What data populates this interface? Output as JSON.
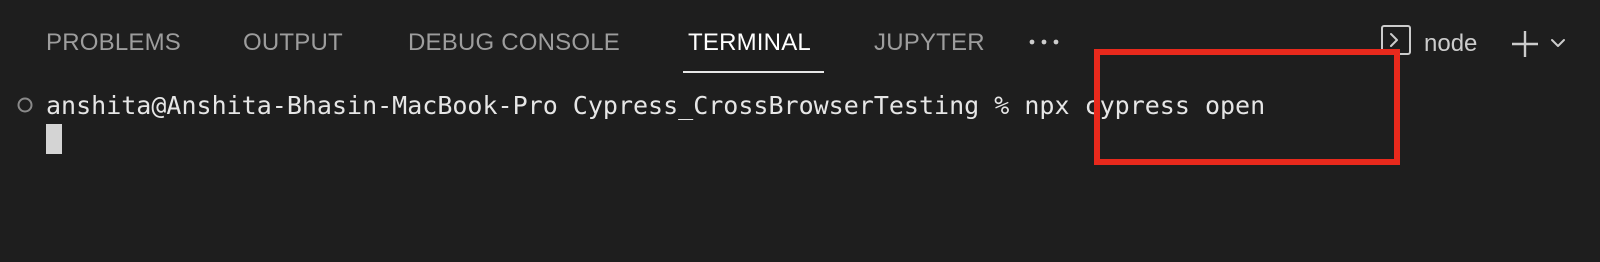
{
  "tabs": [
    {
      "label": "PROBLEMS",
      "active": false
    },
    {
      "label": "OUTPUT",
      "active": false
    },
    {
      "label": "DEBUG CONSOLE",
      "active": false
    },
    {
      "label": "TERMINAL",
      "active": true
    },
    {
      "label": "JUPYTER",
      "active": false
    }
  ],
  "toolbar": {
    "more_icon": "ellipsis-icon",
    "terminal_icon": "terminal-icon",
    "terminal_kind": "node",
    "new_terminal_icon": "plus-icon",
    "dropdown_icon": "chevron-down-icon"
  },
  "terminal": {
    "decoration_icon": "circle-icon",
    "prompt": "anshita@Anshita-Bhasin-MacBook-Pro Cypress_CrossBrowserTesting % ",
    "command": "npx cypress open"
  },
  "annotation": {
    "color": "#e8291c"
  },
  "colors": {
    "background": "#1e1e1e",
    "tab_inactive": "#9d9d9d",
    "tab_active": "#ffffff"
  }
}
